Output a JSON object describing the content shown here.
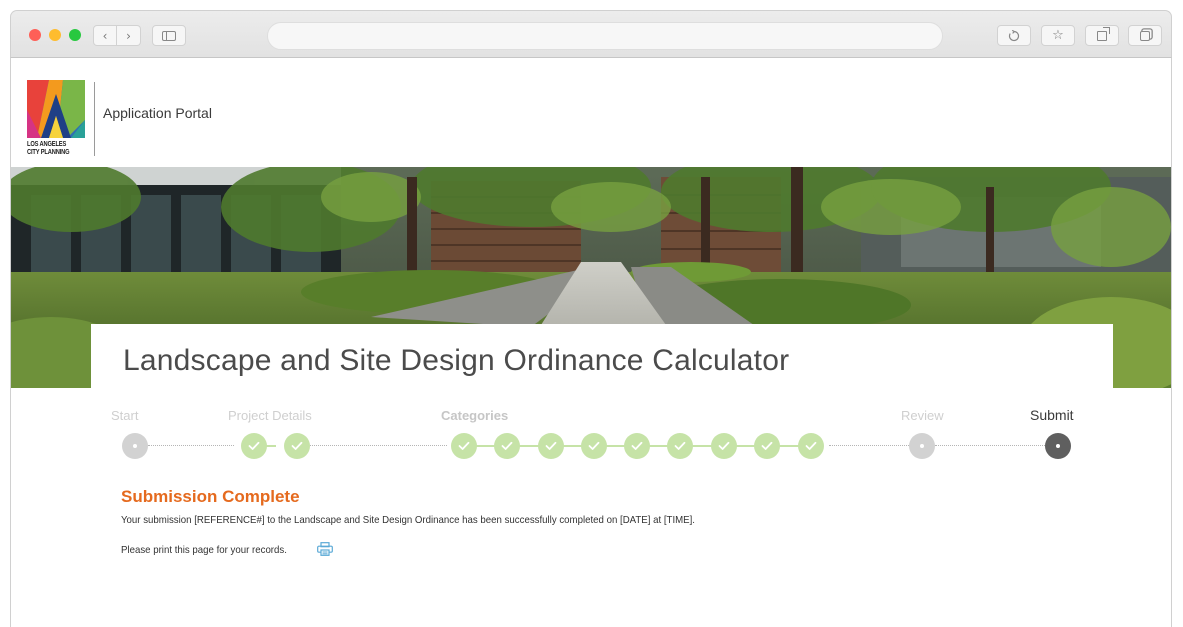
{
  "browser": {
    "controls": {
      "back_icon": "chevron-left-icon",
      "forward_icon": "chevron-right-icon",
      "sidebar_icon": "sidebar-icon",
      "reload_icon": "reload-icon",
      "bookmark_icon": "star-icon",
      "share_icon": "share-icon",
      "tabs_icon": "tabs-overview-icon"
    },
    "address_value": ""
  },
  "header": {
    "logo_text_line1": "LOS ANGELES",
    "logo_text_line2": "CITY PLANNING",
    "portal_title": "Application Portal"
  },
  "page": {
    "title": "Landscape and Site Design Ordinance Calculator"
  },
  "stepper": {
    "labels": {
      "start": "Start",
      "project_details": "Project Details",
      "categories": "Categories",
      "review": "Review",
      "submit": "Submit"
    },
    "colors": {
      "completed": "#c6e3a7",
      "pending": "#d2d2d2",
      "current": "#5f5f5f"
    },
    "completed_steps": 11,
    "current_step": "Submit"
  },
  "completion": {
    "title": "Submission Complete",
    "message": "Your submission [REFERENCE#] to the Landscape and Site Design Ordinance has been successfully completed on [DATE] at [TIME].",
    "print_text": "Please print this page for your records.",
    "print_icon": "printer-icon",
    "title_color": "#e56a1e"
  }
}
